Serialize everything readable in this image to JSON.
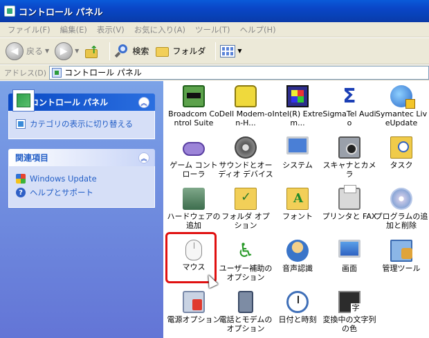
{
  "window": {
    "title": "コントロール パネル"
  },
  "menu": [
    "ファイル(F)",
    "編集(E)",
    "表示(V)",
    "お気に入り(A)",
    "ツール(T)",
    "ヘルプ(H)"
  ],
  "toolbar": {
    "back": "戻る",
    "search": "検索",
    "folders": "フォルダ"
  },
  "address": {
    "label": "アドレス(D)",
    "value": "コントロール パネル"
  },
  "sidebar": {
    "control_panel": {
      "title": "コントロール パネル",
      "link": "カテゴリの表示に切り替える"
    },
    "related": {
      "title": "関連項目",
      "links": [
        "Windows Update",
        "ヘルプとサポート"
      ]
    }
  },
  "items": [
    {
      "label": "Broadcom Control Suite",
      "icon": "network-card-icon"
    },
    {
      "label": "Dell Modem-on-H...",
      "icon": "phone-icon"
    },
    {
      "label": "Intel(R) Extrem...",
      "icon": "graphics-chip-icon"
    },
    {
      "label": "SigmaTel Audio",
      "icon": "sigmatel-icon"
    },
    {
      "label": "Symantec LiveUpdate",
      "icon": "globe-update-icon"
    },
    {
      "label": "ゲーム コントローラ",
      "icon": "gamepad-icon"
    },
    {
      "label": "サウンドとオーディオ デバイス",
      "icon": "speaker-icon"
    },
    {
      "label": "システム",
      "icon": "system-monitor-icon"
    },
    {
      "label": "スキャナとカメラ",
      "icon": "camera-icon"
    },
    {
      "label": "タスク",
      "icon": "scheduled-tasks-icon"
    },
    {
      "label": "ハードウェアの追加",
      "icon": "add-hardware-icon"
    },
    {
      "label": "フォルダ オプション",
      "icon": "folder-options-icon"
    },
    {
      "label": "フォント",
      "icon": "fonts-folder-icon"
    },
    {
      "label": "プリンタと FAX",
      "icon": "printer-icon"
    },
    {
      "label": "プログラムの追加と削除",
      "icon": "add-remove-programs-icon"
    },
    {
      "label": "マウス",
      "icon": "mouse-icon"
    },
    {
      "label": "ユーザー補助のオプション",
      "icon": "accessibility-icon"
    },
    {
      "label": "音声認識",
      "icon": "speech-icon"
    },
    {
      "label": "画面",
      "icon": "display-icon"
    },
    {
      "label": "管理ツール",
      "icon": "admin-tools-icon"
    },
    {
      "label": "電源オプション",
      "icon": "power-options-icon"
    },
    {
      "label": "電話とモデムのオプション",
      "icon": "phone-modem-icon"
    },
    {
      "label": "日付と時刻",
      "icon": "clock-icon"
    },
    {
      "label": "変換中の文字列の色",
      "icon": "ime-color-icon"
    }
  ],
  "colors": {
    "highlight": "#e01010",
    "title_bar": "#0a45c6",
    "sidebar_bg": "#6f8ee0"
  }
}
